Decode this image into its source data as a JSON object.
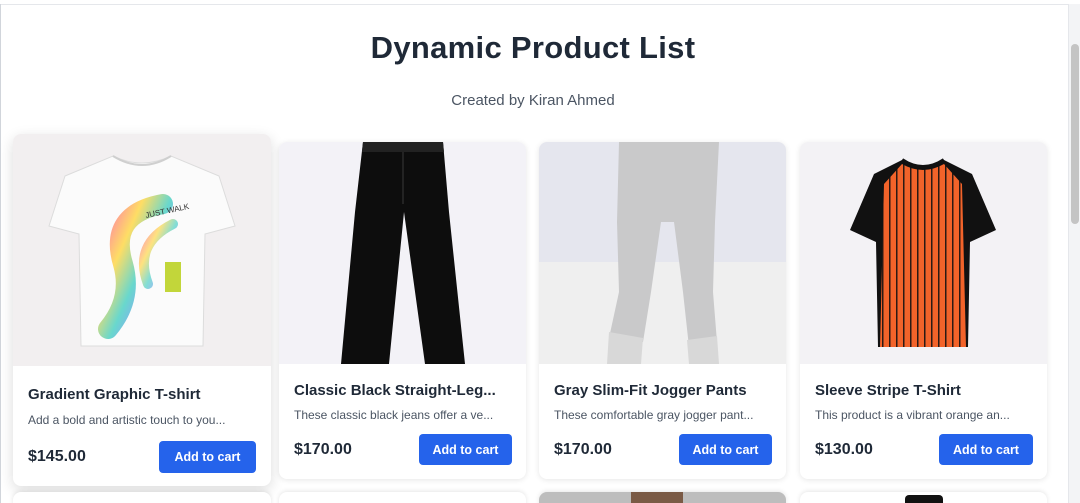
{
  "page": {
    "title": "Dynamic Product List",
    "subtitle": "Created by Kiran Ahmed"
  },
  "products": [
    {
      "name": "Gradient Graphic T-shirt",
      "description": "Add a bold and artistic touch to you...",
      "price": "$145.00",
      "button_label": "Add to cart",
      "image_icon": "gradient-tshirt-image"
    },
    {
      "name": "Classic Black Straight-Leg...",
      "description": "These classic black jeans offer a ve...",
      "price": "$170.00",
      "button_label": "Add to cart",
      "image_icon": "black-jeans-image"
    },
    {
      "name": "Gray Slim-Fit Jogger Pants",
      "description": "These comfortable gray jogger pant...",
      "price": "$170.00",
      "button_label": "Add to cart",
      "image_icon": "gray-joggers-image"
    },
    {
      "name": "Sleeve Stripe T-Shirt",
      "description": "This product is a vibrant orange an...",
      "price": "$130.00",
      "button_label": "Add to cart",
      "image_icon": "striped-tshirt-image"
    }
  ],
  "colors": {
    "accent": "#2563eb",
    "title": "#1f2937",
    "muted": "#4b5563"
  }
}
